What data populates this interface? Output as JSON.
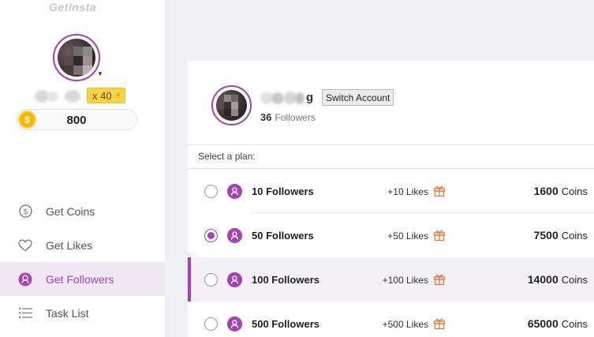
{
  "app": {
    "logo_text": "GetInsta"
  },
  "sidebar": {
    "vip_level": "x 40",
    "coins": "800",
    "nav": [
      {
        "label": "Get Coins",
        "icon": "dollar-circle-icon",
        "active": false
      },
      {
        "label": "Get Likes",
        "icon": "heart-icon",
        "active": false
      },
      {
        "label": "Get Followers",
        "icon": "person-circle-icon",
        "active": true
      },
      {
        "label": "Task List",
        "icon": "list-icon",
        "active": false
      }
    ]
  },
  "profile": {
    "username_visible_suffix": "g",
    "switch_label": "Switch Account",
    "follower_count": "36",
    "followers_label": "Followers"
  },
  "plans": {
    "select_label": "Select a plan:",
    "coins_unit": "Coins",
    "items": [
      {
        "name": "10 Followers",
        "likes": "+10 Likes",
        "price": "1600",
        "selected": false,
        "highlighted": false
      },
      {
        "name": "50 Followers",
        "likes": "+50 Likes",
        "price": "7500",
        "selected": true,
        "highlighted": false
      },
      {
        "name": "100 Followers",
        "likes": "+100 Likes",
        "price": "14000",
        "selected": false,
        "highlighted": true
      },
      {
        "name": "500 Followers",
        "likes": "+500 Likes",
        "price": "65000",
        "selected": false,
        "highlighted": false
      }
    ]
  },
  "colors": {
    "accent": "#a641b6",
    "coin": "#f6b900",
    "vip": "#f7d346",
    "gift": "#e07a3a"
  }
}
